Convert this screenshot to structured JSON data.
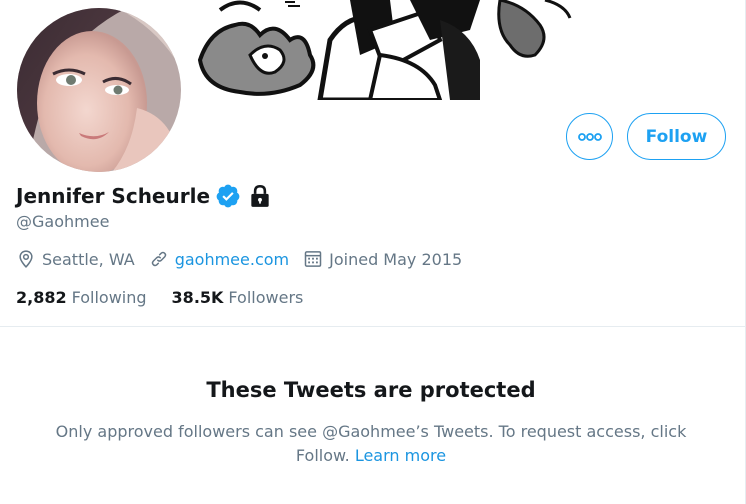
{
  "profile": {
    "display_name": "Jennifer Scheurle",
    "handle": "@Gaohmee",
    "location": "Seattle, WA",
    "website": "gaohmee.com",
    "joined": "Joined May 2015",
    "verified": true,
    "protected": true
  },
  "stats": {
    "following_count": "2,882",
    "following_label": "Following",
    "followers_count": "38.5K",
    "followers_label": "Followers"
  },
  "actions": {
    "follow_label": "Follow",
    "more_icon": "more-horizontal-icon"
  },
  "protected_notice": {
    "title": "These Tweets are protected",
    "body_part1": "Only approved followers can see @Gaohmee’s Tweets. To request access, click Follow.",
    "learn_more": "Learn more"
  },
  "colors": {
    "accent": "#1da1f2",
    "link": "#1b95e0",
    "text_primary": "#14171a",
    "text_secondary": "#657786",
    "border": "#e6ecf0"
  }
}
